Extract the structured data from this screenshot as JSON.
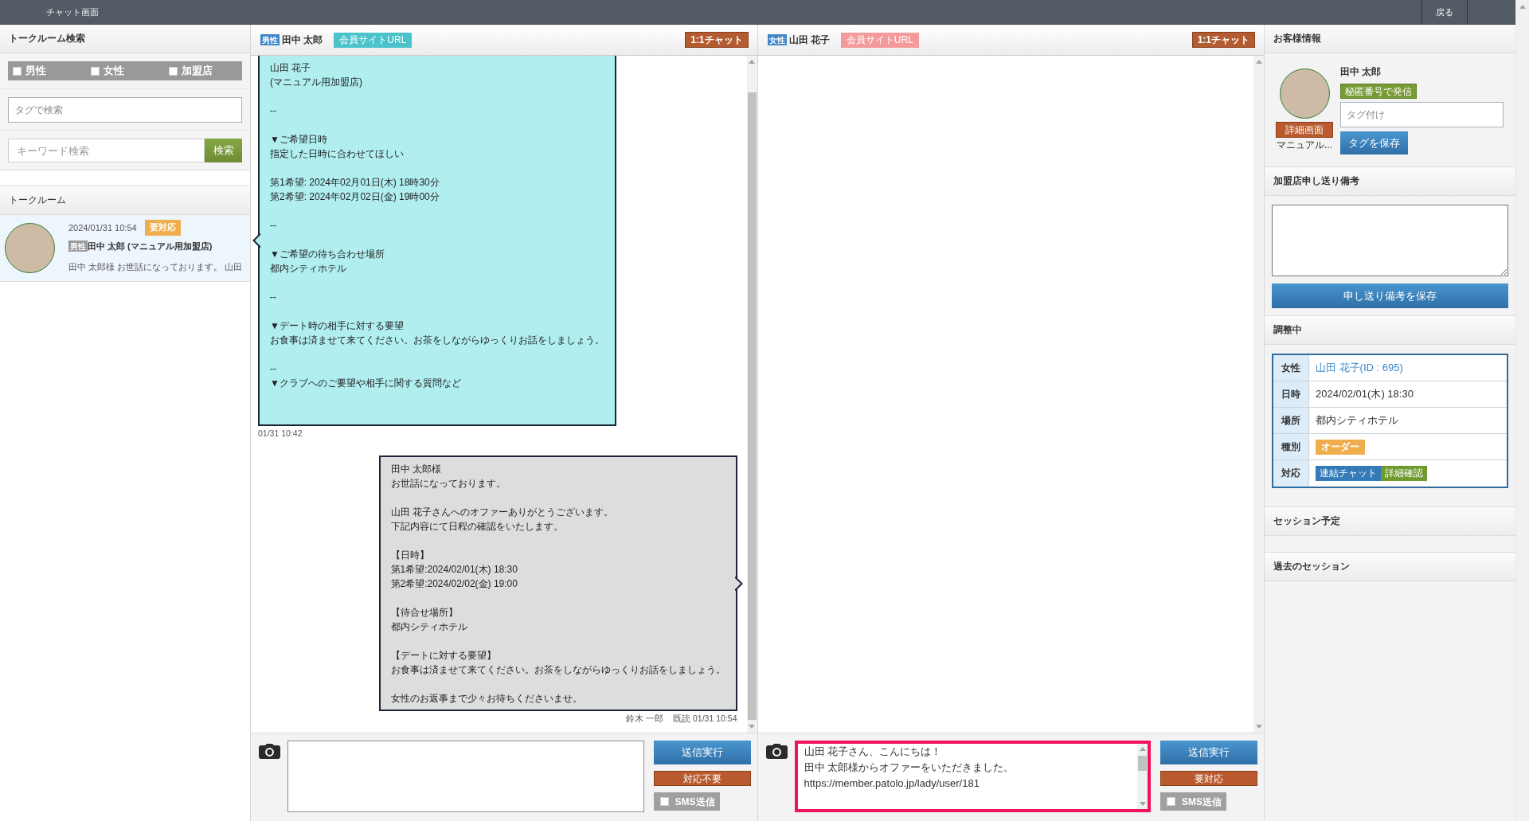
{
  "top_bar": {
    "title": "チャット画面",
    "back_button": "戻る"
  },
  "room_search": {
    "title": "トークルーム検索",
    "filters": [
      {
        "label": "男性",
        "checked": false
      },
      {
        "label": "女性",
        "checked": false
      },
      {
        "label": "加盟店",
        "checked": false
      }
    ],
    "tag_search": {
      "placeholder": "タグで検索"
    },
    "keyword_search": {
      "placeholder": "キーワード検索",
      "button": "検索"
    }
  },
  "talk_rooms": {
    "title": "トークルーム",
    "rooms": [
      {
        "selected": true,
        "time": "2024/01/31 10:54",
        "status": "要対応",
        "gender": "男性",
        "name": "田中 太郎 (マニュアル用加盟店)",
        "preview": "田中 太郎様 お世話になっております。 山田"
      }
    ]
  },
  "chats": [
    {
      "gender": "男性",
      "name": "田中 太郎",
      "url_button": {
        "label": "会員サイトURL",
        "color": "#4bc3cb"
      },
      "chat_button": "1:1チャット",
      "messages": [
        {
          "kind": "received",
          "paragraphs": [
            {
              "lines": [
                "山田 花子",
                "(マニュアル用加盟店)"
              ]
            },
            {
              "lines": [
                "--"
              ]
            },
            {
              "lines": [
                "▼ご希望日時",
                "指定した日時に合わせてほしい"
              ]
            },
            {
              "lines": [
                "第1希望: 2024年02月01日(木) 18時30分",
                "第2希望: 2024年02月02日(金) 19時00分"
              ]
            },
            {
              "lines": [
                "--"
              ]
            },
            {
              "lines": [
                "▼ご希望の待ち合わせ場所",
                "都内シティホテル"
              ]
            },
            {
              "lines": [
                "--"
              ]
            },
            {
              "lines": [
                "▼デート時の相手に対する要望",
                "お食事は済ませて来てください。お茶をしながらゆっくりお話をしましょう。"
              ]
            },
            {
              "lines": [
                "--",
                "▼クラブへのご要望や相手に関する質問など"
              ]
            }
          ],
          "time": "01/31 10:42"
        },
        {
          "kind": "sent",
          "paragraphs": [
            {
              "lines": [
                "田中 太郎様",
                "お世話になっております。"
              ]
            },
            {
              "lines": [
                "山田 花子さんへのオファーありがとうございます。",
                "下記内容にて日程の確認をいたします。"
              ]
            },
            {
              "lines": [
                "【日時】",
                "第1希望:2024/02/01(木) 18:30",
                "第2希望:2024/02/02(金) 19:00"
              ]
            },
            {
              "lines": [
                "【待合せ場所】",
                "都内シティホテル"
              ]
            },
            {
              "lines": [
                "【デートに対する要望】",
                "お食事は済ませて来てください。お茶をしながらゆっくりお話をしましょう。"
              ]
            },
            {
              "lines": [
                "女性のお返事まで少々お待ちくださいませ。"
              ]
            }
          ],
          "sender": "鈴木 一郎",
          "read": "既読 01/31 10:54"
        }
      ],
      "composer": {
        "highlighted": false,
        "send_button": "送信実行",
        "status_button": "対応不要",
        "sms": {
          "label": "SMS送信",
          "checked": false
        }
      }
    },
    {
      "gender": "女性",
      "name": "山田 花子",
      "url_button": {
        "label": "会員サイトURL",
        "color": "#f59a9a"
      },
      "chat_button": "1:1チャット",
      "composer": {
        "value_lines": [
          "山田 花子さん、こんにちは！",
          "田中 太郎様からオファーをいただきました。",
          "https://member.patolo.jp/lady/user/181"
        ],
        "highlighted": true,
        "send_button": "送信実行",
        "status_button": "要対応",
        "sms": {
          "label": "SMS送信",
          "checked": false
        }
      }
    }
  ],
  "customer": {
    "title": "お客様情報",
    "name": "田中 太郎",
    "call_badge": "秘匿番号で発信",
    "detail_button": "詳細画面",
    "shop": "マニュアル...",
    "tag_input": {
      "placeholder": "タグ付け"
    },
    "tag_save_button": "タグを保存"
  },
  "shop_notes": {
    "title": "加盟店申し送り備考",
    "save_button": "申し送り備考を保存"
  },
  "arrangement": {
    "title": "調整中",
    "rows": [
      {
        "label": "女性",
        "kind": "link",
        "value": "山田 花子(ID : 695)"
      },
      {
        "label": "日時",
        "kind": "text",
        "value": "2024/02/01(木) 18:30"
      },
      {
        "label": "場所",
        "kind": "text",
        "value": "都内シティホテル"
      },
      {
        "label": "種別",
        "kind": "badge",
        "badges": [
          {
            "label": "オーダー",
            "color": "#f0ad4e"
          }
        ]
      },
      {
        "label": "対応",
        "kind": "buttons",
        "badges": [
          {
            "label": "連結チャット",
            "color": "#337ab7"
          },
          {
            "label": "詳細確認",
            "color": "#6f9a2e"
          }
        ]
      }
    ]
  },
  "sections": [
    {
      "title": "セッション予定"
    },
    {
      "title": "過去のセッション"
    }
  ]
}
